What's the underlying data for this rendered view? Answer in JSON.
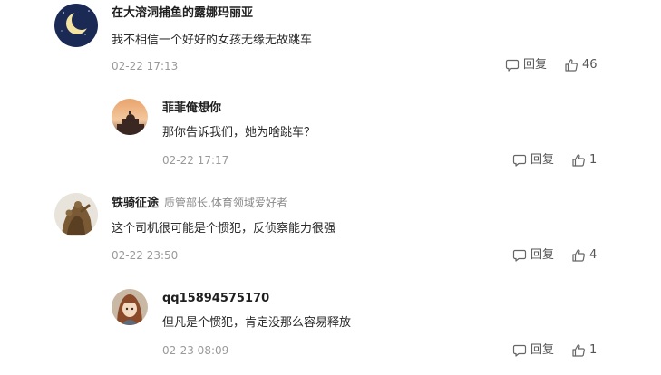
{
  "comments": [
    {
      "name": "在大溶洞捕鱼的露娜玛丽亚",
      "tag": "",
      "text": "我不相信一个好好的女孩无缘无故跳车",
      "time": "02-22 17:13",
      "reply_label": "回复",
      "like_count": "46",
      "avatar_icon": "moon-night-avatar"
    },
    {
      "name": "菲菲俺想你",
      "tag": "",
      "text": "那你告诉我们，她为啥跳车？",
      "time": "02-22 17:17",
      "reply_label": "回复",
      "like_count": "1",
      "avatar_icon": "sunset-dome-avatar"
    },
    {
      "name": "铁骑征途",
      "tag": "质管部长,体育领域爱好者",
      "text": "这个司机很可能是个惯犯，反侦察能力很强",
      "time": "02-22 23:50",
      "reply_label": "回复",
      "like_count": "4",
      "avatar_icon": "sculpture-avatar"
    },
    {
      "name": "qq15894575170",
      "tag": "",
      "text": "但凡是个惯犯，肯定没那么容易释放",
      "time": "02-23 08:09",
      "reply_label": "回复",
      "like_count": "1",
      "avatar_icon": "anime-girl-avatar"
    }
  ],
  "icons": {
    "reply": "comment-bubble-icon",
    "like": "thumbs-up-icon"
  },
  "colors": {
    "name": "#1f1f1f",
    "text": "#2b2b2b",
    "meta": "#9a9a9a",
    "action": "#555555"
  }
}
